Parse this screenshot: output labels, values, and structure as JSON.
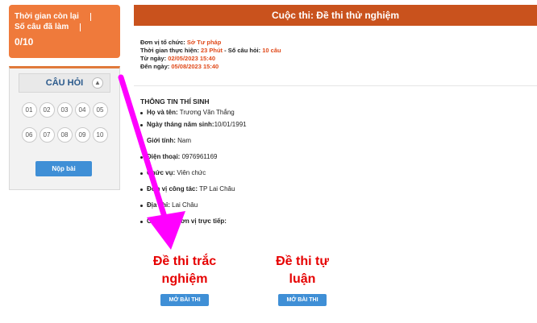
{
  "timer": {
    "remaining_label": "Thời gian còn lại",
    "answered_label": "Số câu đã làm",
    "count": "0/10"
  },
  "questions": {
    "title": "CÂU HỎI",
    "row1": [
      "01",
      "02",
      "03",
      "04",
      "05"
    ],
    "row2": [
      "06",
      "07",
      "08",
      "09",
      "10"
    ],
    "submit_label": "Nộp bài"
  },
  "exam": {
    "title": "Cuộc thi: Đề thi thử nghiệm",
    "org_label": "Đơn vị tổ chức:",
    "org_value": "Sở Tư pháp",
    "duration_label": "Thời gian thực hiện:",
    "duration_value": "23 Phút",
    "count_label": "- Số câu hỏi:",
    "count_value": "10 câu",
    "from_label": "Từ ngày:",
    "from_value": "02/05/2023 15:40",
    "to_label": "Đến ngày:",
    "to_value": "05/08/2023 15:40"
  },
  "candidate": {
    "heading": "THÔNG TIN THÍ SINH",
    "rows": [
      {
        "label": "Họ và tên:",
        "value": "Trương Văn Thắng"
      },
      {
        "label": "Ngày tháng năm sinh:",
        "value": "10/01/1991"
      },
      {
        "label": "Giới tính:",
        "value": "Nam"
      },
      {
        "label": "Điện thoại:",
        "value": "0976961169"
      },
      {
        "label": "Chức vụ:",
        "value": "Viên chức"
      },
      {
        "label": "Đơn vị công tác:",
        "value": "TP Lai Châu"
      },
      {
        "label": "Địa chỉ:",
        "value": "Lai Châu"
      },
      {
        "label": "Cơ quan, đơn vị trực tiếp:",
        "value": ""
      }
    ]
  },
  "options": {
    "mcq_line1": "Đề thi trắc",
    "mcq_line2": "nghiệm",
    "essay_line1": "Đề thi tự",
    "essay_line2": "luận",
    "open_label": "MỞ BÀI THI"
  },
  "colors": {
    "accent_orange": "#ef7a3b",
    "title_bar": "#c9521d",
    "button_blue": "#3f8fd6",
    "option_red": "#e60000",
    "annotation_arrow": "#ff00ff"
  }
}
